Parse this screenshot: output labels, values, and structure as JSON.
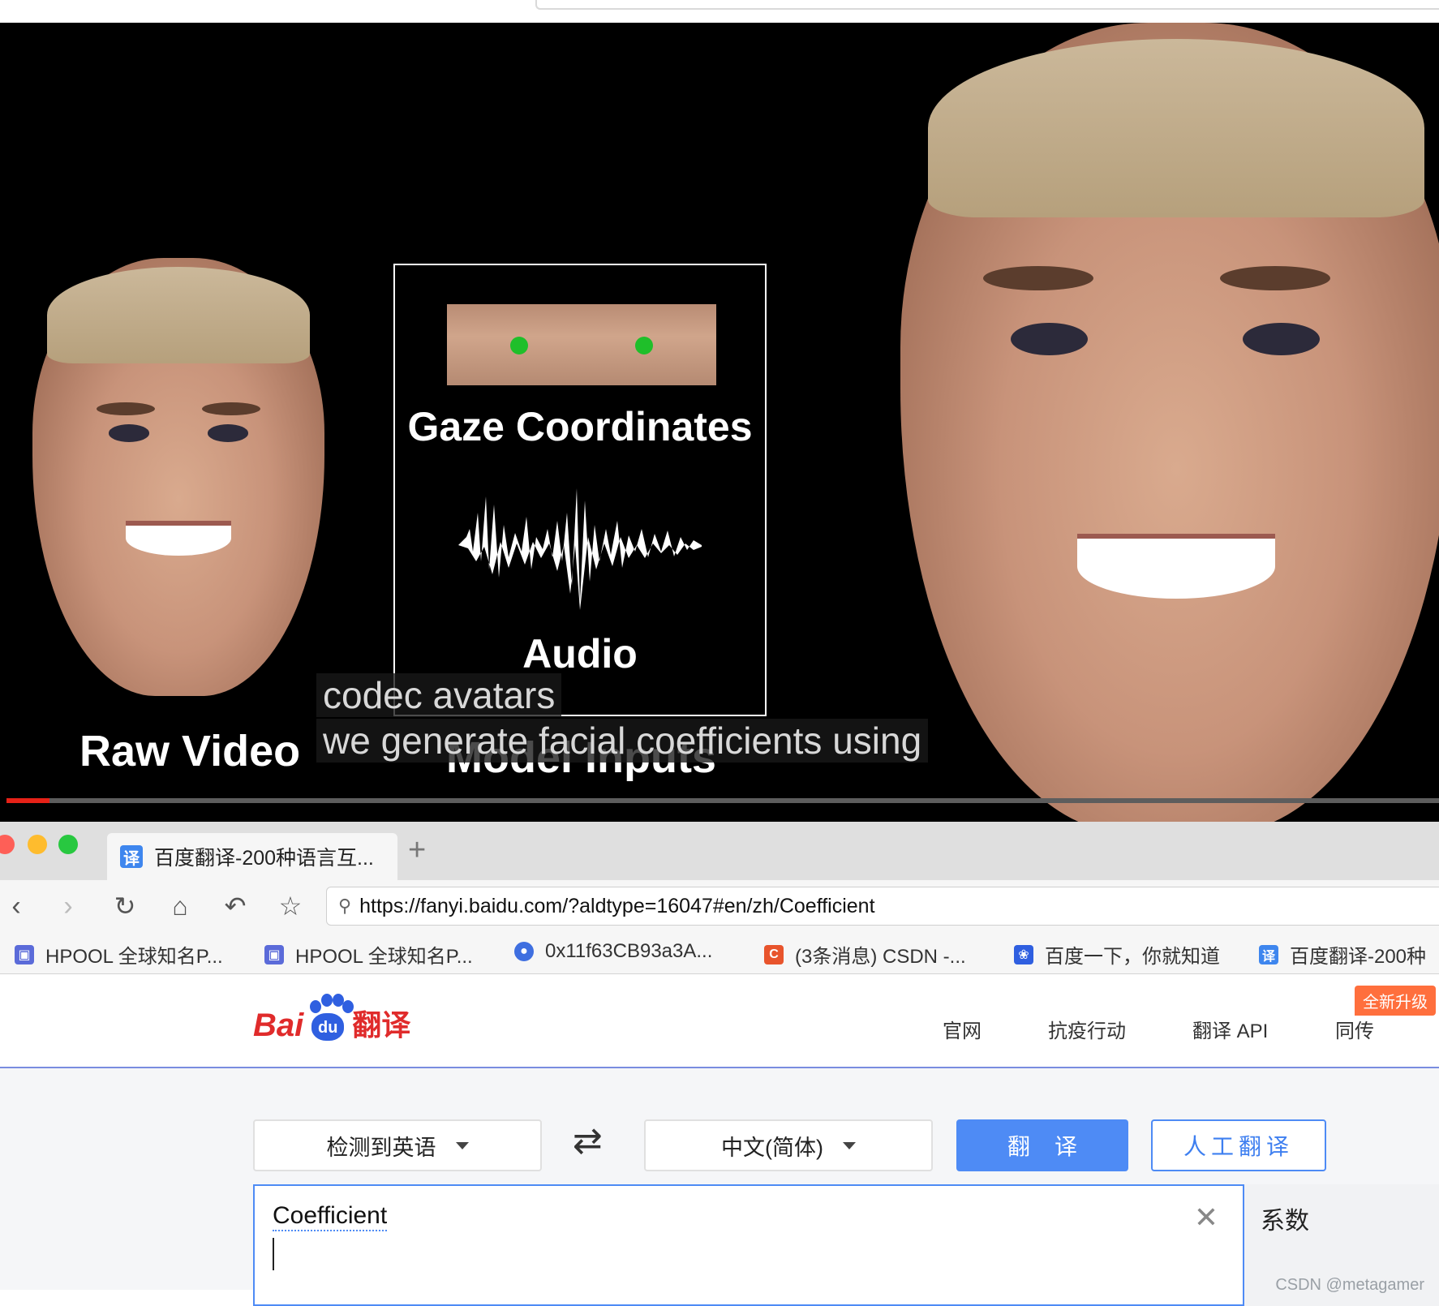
{
  "video": {
    "gaze_label": "Gaze Coordinates",
    "audio_label": "Audio",
    "raw_label": "Raw Video",
    "model_label": "Model Inputs",
    "caption_line1": "codec avatars",
    "caption_line2": "we generate facial coefficients using",
    "progress_fraction": 0.03
  },
  "browser": {
    "tab": {
      "favicon": "译",
      "title": "百度翻译-200种语言互..."
    },
    "new_tab_symbol": "+",
    "nav_icons": [
      "back-icon",
      "forward-icon",
      "reload-icon",
      "home-icon",
      "undo-icon",
      "star-icon"
    ],
    "url": "https://fanyi.baidu.com/?aldtype=16047#en/zh/Coefficient",
    "bookmarks": [
      {
        "label": "HPOOL 全球知名P...",
        "icon": "hpool-icon",
        "color": "#5b6bd9",
        "glyph": "▣"
      },
      {
        "label": "HPOOL 全球知名P...",
        "icon": "hpool-icon",
        "color": "#5b6bd9",
        "glyph": "▣"
      },
      {
        "label": "0x11f63CB93a3A...",
        "icon": "drop-icon",
        "color": "#3f6fe0",
        "glyph": "●"
      },
      {
        "label": "(3条消息) CSDN -...",
        "icon": "csdn-icon",
        "color": "#e8542c",
        "glyph": "C"
      },
      {
        "label": "百度一下，你就知道",
        "icon": "baidu-paw-icon",
        "color": "#2f5fe0",
        "glyph": "❀"
      },
      {
        "label": "百度翻译-200种",
        "icon": "baidu-translate-icon",
        "color": "#3e86ee",
        "glyph": "译"
      }
    ]
  },
  "baidu": {
    "logo": {
      "bai": "Bai",
      "du": "du",
      "fanyi": "翻译"
    },
    "nav": [
      "官网",
      "抗疫行动",
      "翻译 API",
      "同传"
    ],
    "badge": "全新升级",
    "source_lang": "检测到英语",
    "target_lang": "中文(简体)",
    "translate_button": "翻译",
    "human_button": "人工翻译",
    "source_text": "Coefficient",
    "result_text": "系数",
    "watermark": "CSDN @metagamer"
  },
  "colors": {
    "accent": "#4e8bf5",
    "logo_red": "#e02b2b",
    "progress_red": "#e62117",
    "badge_orange": "#ff6f3d"
  }
}
